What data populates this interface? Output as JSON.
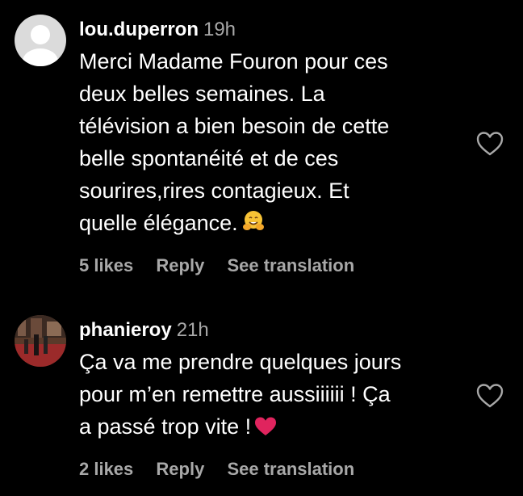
{
  "comments": [
    {
      "username": "lou.duperron",
      "time": "19h",
      "avatar": "default-avatar-icon",
      "lines": [
        "Merci Madame Fouron pour ces",
        "deux belles semaines. La",
        "télévision a bien besoin de cette",
        "belle spontanéité et de ces",
        "sourires,rires contagieux. Et",
        "quelle élégance."
      ],
      "emoji": "hugging-face-icon",
      "likes": "5 likes",
      "reply": "Reply",
      "translate": "See translation"
    },
    {
      "username": "phanieroy",
      "time": "21h",
      "avatar": "photo-avatar-icon",
      "lines": [
        "Ça va me prendre quelques jours",
        "pour m’en remettre aussiiiiii ! Ça",
        "a passé trop vite !"
      ],
      "emoji": "red-heart-icon",
      "likes": "2 likes",
      "reply": "Reply",
      "translate": "See translation"
    }
  ],
  "colors": {
    "background": "#000000",
    "text": "#ffffff",
    "muted": "#a8a8a8",
    "heart": "#e0245e"
  }
}
